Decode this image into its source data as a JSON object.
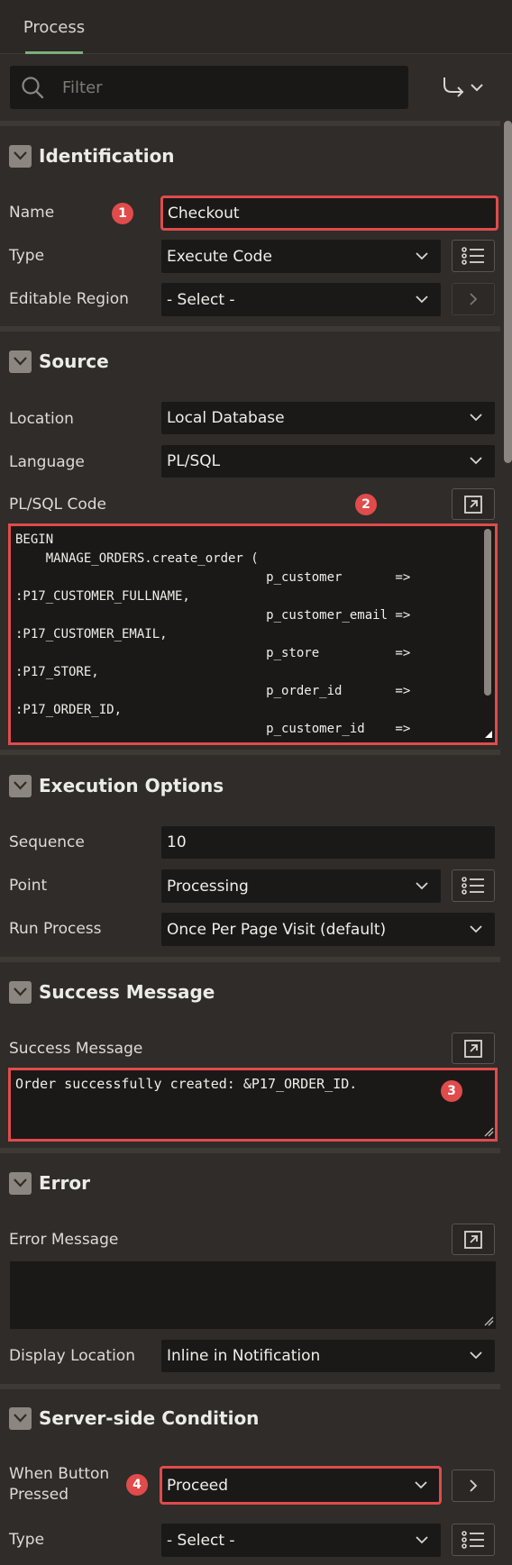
{
  "header": {
    "tab_process": "Process"
  },
  "filter": {
    "placeholder": "Filter"
  },
  "identification": {
    "title": "Identification",
    "name_label": "Name",
    "name_value": "Checkout",
    "type_label": "Type",
    "type_value": "Execute Code",
    "editable_region_label": "Editable Region",
    "editable_region_value": "- Select -"
  },
  "source": {
    "title": "Source",
    "location_label": "Location",
    "location_value": "Local Database",
    "language_label": "Language",
    "language_value": "PL/SQL",
    "code_label": "PL/SQL Code",
    "code_value": "BEGIN\n    MANAGE_ORDERS.create_order (\n                                 p_customer       =>\n:P17_CUSTOMER_FULLNAME,\n                                 p_customer_email =>\n:P17_CUSTOMER_EMAIL,\n                                 p_store          =>\n:P17_STORE,\n                                 p_order_id       =>\n:P17_ORDER_ID,\n                                 p_customer_id    =>"
  },
  "execution": {
    "title": "Execution Options",
    "sequence_label": "Sequence",
    "sequence_value": "10",
    "point_label": "Point",
    "point_value": "Processing",
    "run_process_label": "Run Process",
    "run_process_value": "Once Per Page Visit (default)"
  },
  "success": {
    "title": "Success Message",
    "message_label": "Success Message",
    "message_value": "Order successfully created: &P17_ORDER_ID."
  },
  "error": {
    "title": "Error",
    "message_label": "Error Message",
    "message_value": "",
    "display_location_label": "Display Location",
    "display_location_value": "Inline in Notification"
  },
  "condition": {
    "title": "Server-side Condition",
    "when_button_label_line1": "When Button",
    "when_button_label_line2": "Pressed",
    "when_button_value": "Proceed",
    "type_label": "Type",
    "type_value": "- Select -"
  },
  "badges": {
    "b1": "1",
    "b2": "2",
    "b3": "3",
    "b4": "4"
  },
  "colors": {
    "highlight": "#e04b4b",
    "accent_tab": "#7cae7c",
    "field_bg": "#1b1918",
    "panel_bg": "#2f2c29"
  }
}
